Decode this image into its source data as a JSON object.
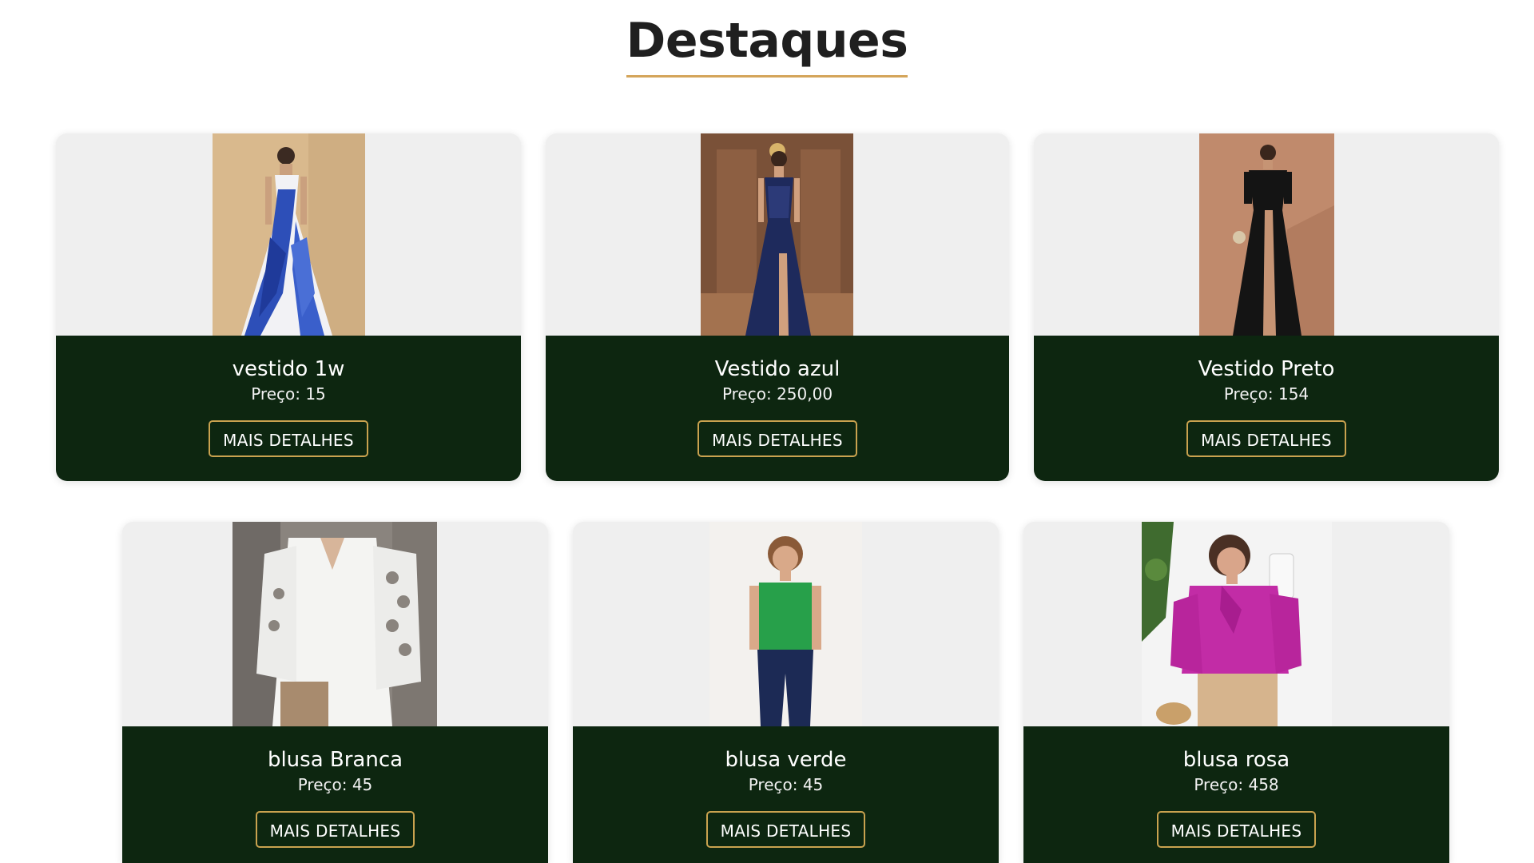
{
  "section": {
    "title": "Destaques",
    "accent_color": "#d4a55a"
  },
  "theme": {
    "card_body_color": "#0d2610",
    "card_media_bg": "#efefef",
    "button_border_color": "#c9a24f"
  },
  "products": [
    {
      "name": "vestido 1w",
      "price_text": "Preço: 15",
      "button_label": "MAIS DETALHES",
      "image_icon": "blue-floral-maxi-dress-photo"
    },
    {
      "name": "Vestido azul",
      "price_text": "Preço: 250,00",
      "button_label": "MAIS DETALHES",
      "image_icon": "navy-evening-gown-photo"
    },
    {
      "name": "Vestido Preto",
      "price_text": "Preço: 154",
      "button_label": "MAIS DETALHES",
      "image_icon": "black-slit-dress-photo"
    },
    {
      "name": "blusa Branca",
      "price_text": "Preço: 45",
      "button_label": "MAIS DETALHES",
      "image_icon": "white-lace-sleeve-blouse-photo"
    },
    {
      "name": "blusa verde",
      "price_text": "Preço: 45",
      "button_label": "MAIS DETALHES",
      "image_icon": "green-sleeveless-blouse-photo"
    },
    {
      "name": "blusa rosa",
      "price_text": "Preço: 458",
      "button_label": "MAIS DETALHES",
      "image_icon": "magenta-bow-blouse-photo"
    }
  ]
}
